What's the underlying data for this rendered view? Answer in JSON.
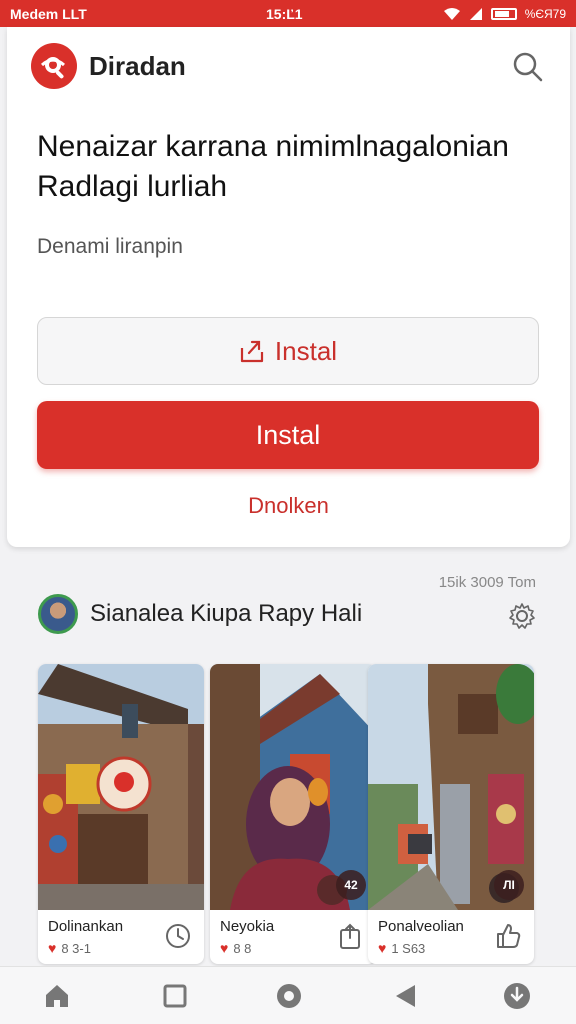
{
  "status_bar": {
    "carrier": "Medem  LLT",
    "time": "15:Ľ1",
    "battery": "%ЄЯ79"
  },
  "app": {
    "name": "Diradan",
    "icons": {
      "logo": "search-logo-icon",
      "search": "search-icon"
    }
  },
  "hero": {
    "headline_line1": "Nenaizar karrana nimimlnagalonian",
    "headline_line2": "Radlagi lurliah",
    "subtext": "Denami liranpin"
  },
  "actions": {
    "install_outline_label": "Instal",
    "install_solid_label": "Instal",
    "link_label": "Dnolken"
  },
  "feed": {
    "meta": "15ik 3009 Tom",
    "title": "Sianalea Kiupa Rарy Hali",
    "cards": [
      {
        "caption": "Dolinankan",
        "likes": "8 3-1",
        "action_icon": "clock-icon"
      },
      {
        "caption": "Neyokia",
        "likes": "8 8",
        "action_icon": "share-icon",
        "badge": "42"
      },
      {
        "caption": "Ponalveolian",
        "likes": "1 S63",
        "action_icon": "thumbs-up-icon",
        "badge": "ЛІ"
      }
    ]
  },
  "bottom_nav": [
    "home-icon",
    "square-icon",
    "circle-icon",
    "back-icon",
    "download-icon"
  ],
  "colors": {
    "accent": "#d9302a",
    "background": "#f2f2f4"
  }
}
